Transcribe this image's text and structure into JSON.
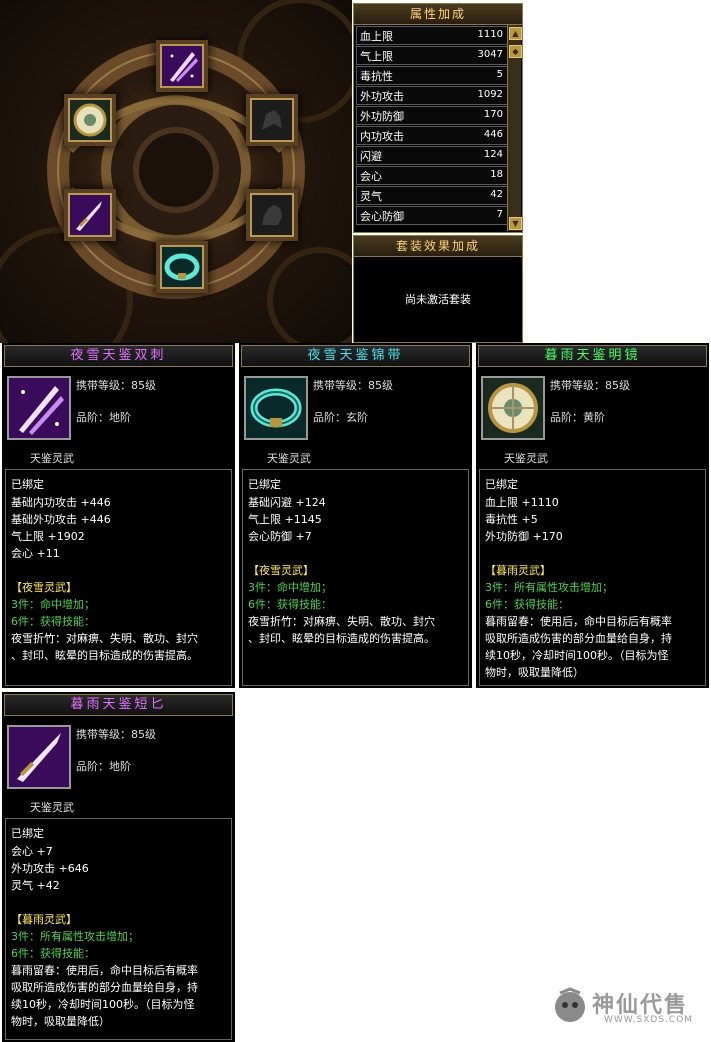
{
  "attributes": {
    "title": "属性加成",
    "rows": [
      {
        "label": "血上限",
        "value": "1110"
      },
      {
        "label": "气上限",
        "value": "3047"
      },
      {
        "label": "毒抗性",
        "value": "5"
      },
      {
        "label": "外功攻击",
        "value": "1092"
      },
      {
        "label": "外功防御",
        "value": "170"
      },
      {
        "label": "内功攻击",
        "value": "446"
      },
      {
        "label": "闪避",
        "value": "124"
      },
      {
        "label": "会心",
        "value": "18"
      },
      {
        "label": "灵气",
        "value": "42"
      },
      {
        "label": "会心防御",
        "value": "7"
      }
    ]
  },
  "set_bonus": {
    "title": "套装效果加成",
    "message": "尚未激活套装"
  },
  "items": [
    {
      "name": "夜雪天鉴双刺",
      "name_color": "#e070ff",
      "icon": "dual-blade-icon",
      "level_label": "携带等级：85级",
      "grade_label": "品阶：地阶",
      "series": "天鉴灵武",
      "bound": "已绑定",
      "stats": [
        "基础内功攻击 +446",
        "基础外功攻击 +446",
        "气上限 +1902",
        "会心 +11"
      ],
      "set_name": "【夜雪灵武】",
      "set_3": "3件：命中增加；",
      "set_6": "6件：获得技能：",
      "skill_lines": [
        "夜雪折竹：对麻痹、失明、散功、封穴",
        "、封印、眩晕的目标造成的伤害提高。"
      ]
    },
    {
      "name": "夜雪天鉴锦带",
      "name_color": "#44e0e8",
      "icon": "belt-icon",
      "level_label": "携带等级：85级",
      "grade_label": "品阶：玄阶",
      "series": "天鉴灵武",
      "bound": "已绑定",
      "stats": [
        "基础闪避 +124",
        "气上限 +1145",
        "会心防御 +7"
      ],
      "set_name": "【夜雪灵武】",
      "set_3": "3件：命中增加；",
      "set_6": "6件：获得技能：",
      "skill_lines": [
        "夜雪折竹：对麻痹、失明、散功、封穴",
        "、封印、眩晕的目标造成的伤害提高。"
      ]
    },
    {
      "name": "暮雨天鉴明镜",
      "name_color": "#44ff66",
      "icon": "mirror-icon",
      "level_label": "携带等级：85级",
      "grade_label": "品阶：黄阶",
      "series": "天鉴灵武",
      "bound": "已绑定",
      "stats": [
        "血上限 +1110",
        "毒抗性 +5",
        "外功防御 +170"
      ],
      "set_name": "【暮雨灵武】",
      "set_3": "3件：所有属性攻击增加；",
      "set_6": "6件：获得技能：",
      "skill_lines": [
        "暮雨留春：使用后，命中目标后有概率",
        "吸取所造成伤害的部分血量给自身，持",
        "续10秒，冷却时间100秒。（目标为怪",
        "物时，吸取量降低）"
      ]
    },
    {
      "name": "暮雨天鉴短匕",
      "name_color": "#e070ff",
      "icon": "dagger-icon",
      "level_label": "携带等级：85级",
      "grade_label": "品阶：地阶",
      "series": "天鉴灵武",
      "bound": "已绑定",
      "stats": [
        "会心 +7",
        "外功攻击 +646",
        "灵气 +42"
      ],
      "set_name": "【暮雨灵武】",
      "set_3": "3件：所有属性攻击增加；",
      "set_6": "6件：获得技能：",
      "skill_lines": [
        "暮雨留春：使用后，命中目标后有概率",
        "吸取所造成伤害的部分血量给自身，持",
        "续10秒，冷却时间100秒。（目标为怪",
        "物时，吸取量降低）"
      ]
    }
  ],
  "watermark": {
    "brand": "神仙代售",
    "url": "WWW.SXDS.COM"
  },
  "colors": {
    "gold_border": "#8a7a4a",
    "header_text": "#ffd37a",
    "set_text": "#ffe65a",
    "bonus_text": "#4ed04e"
  }
}
